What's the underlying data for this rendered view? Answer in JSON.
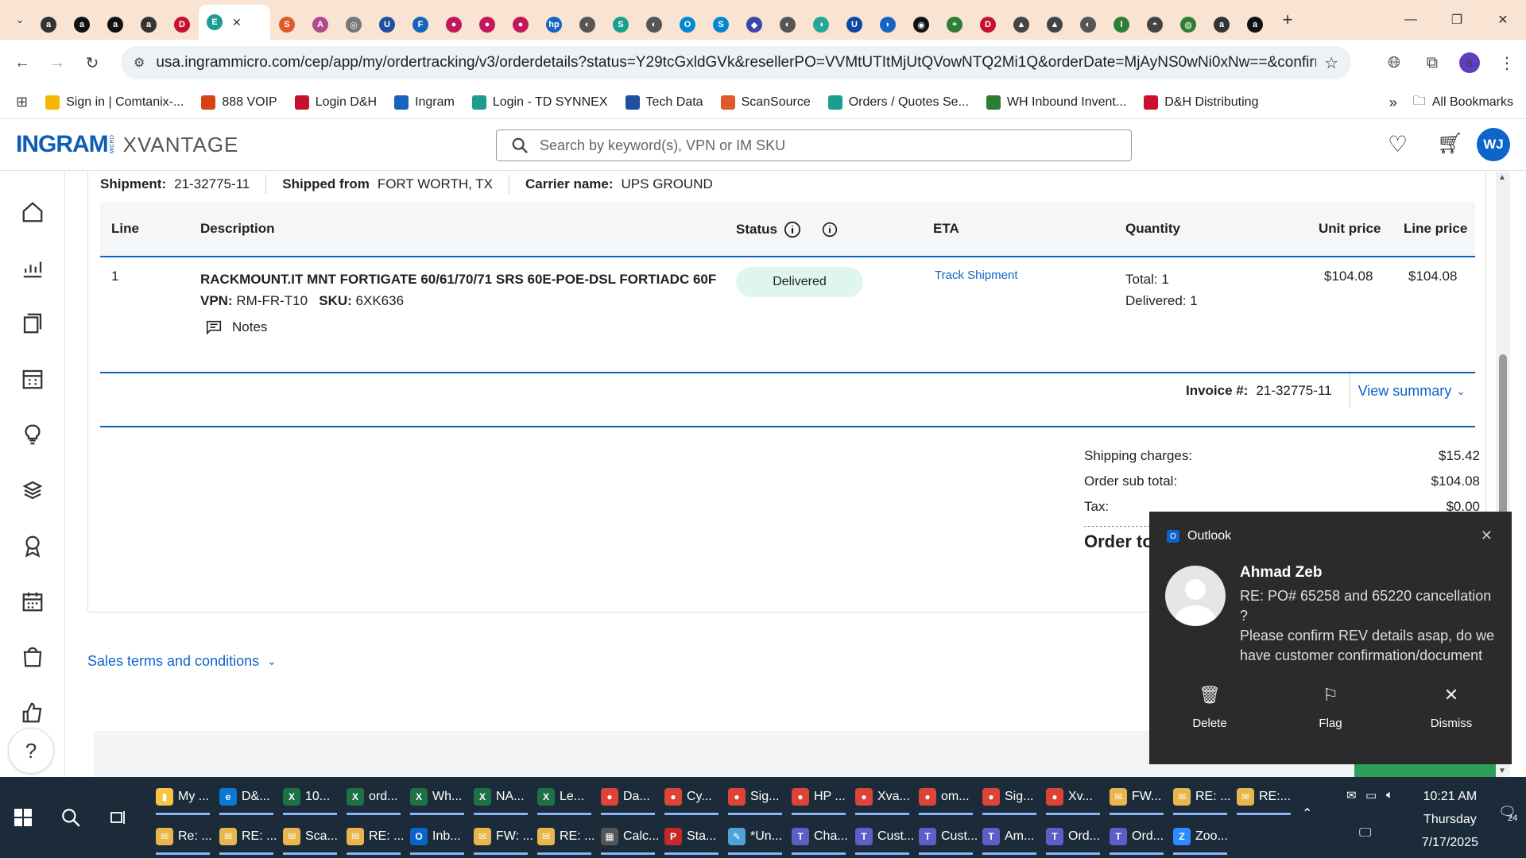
{
  "browser": {
    "url": "usa.ingrammicro.com/cep/app/my/ordertracking/v3/orderdetails?status=Y29tcGxldGVk&resellerPO=VVMtUTItMjUtQVowNTQ2Mi1Q&orderDate=MjAyNS0wNi0xNw==&confirmationNu...",
    "profile_initial": "B",
    "tabs": [
      {
        "color": "#333333",
        "glyph": "a"
      },
      {
        "color": "#111111",
        "glyph": "a"
      },
      {
        "color": "#111111",
        "glyph": "a"
      },
      {
        "color": "#333333",
        "glyph": "a"
      },
      {
        "color": "#c8102e",
        "glyph": "D"
      },
      {
        "color": "#1a9e8f",
        "glyph": "E"
      },
      {
        "color": "#e0592a",
        "glyph": "S"
      },
      {
        "color": "#b14a8a",
        "glyph": "A"
      },
      {
        "color": "#777777",
        "glyph": "◎"
      },
      {
        "color": "#1f4fa0",
        "glyph": "U"
      },
      {
        "color": "#1565c0",
        "glyph": "F"
      },
      {
        "color": "#c2185b",
        "glyph": "●"
      },
      {
        "color": "#c2185b",
        "glyph": "●"
      },
      {
        "color": "#c2185b",
        "glyph": "●"
      },
      {
        "color": "#1565c0",
        "glyph": "hp"
      },
      {
        "color": "#555555",
        "glyph": "◐"
      },
      {
        "color": "#1a9e8f",
        "glyph": "S"
      },
      {
        "color": "#555555",
        "glyph": "◐"
      },
      {
        "color": "#0288d1",
        "glyph": "O"
      },
      {
        "color": "#0288d1",
        "glyph": "S"
      },
      {
        "color": "#3949ab",
        "glyph": "◆"
      },
      {
        "color": "#555555",
        "glyph": "◐"
      },
      {
        "color": "#26a69a",
        "glyph": "◑"
      },
      {
        "color": "#0d47a1",
        "glyph": "U"
      },
      {
        "color": "#1565c0",
        "glyph": "◗"
      },
      {
        "color": "#111111",
        "glyph": "◉"
      },
      {
        "color": "#2e7d32",
        "glyph": "+"
      },
      {
        "color": "#c8102e",
        "glyph": "D"
      },
      {
        "color": "#444444",
        "glyph": "▲"
      },
      {
        "color": "#444444",
        "glyph": "▲"
      },
      {
        "color": "#555555",
        "glyph": "◐"
      },
      {
        "color": "#2e7d32",
        "glyph": "l"
      },
      {
        "color": "#444444",
        "glyph": "◓"
      },
      {
        "color": "#2e7d32",
        "glyph": "◍"
      },
      {
        "color": "#333333",
        "glyph": "a"
      },
      {
        "color": "#111111",
        "glyph": "a"
      }
    ],
    "bookmarks": [
      {
        "label": "Sign in | Comtanix-...",
        "color": "#f5b800"
      },
      {
        "label": "888 VOIP",
        "color": "#d84315"
      },
      {
        "label": "Login D&H",
        "color": "#c8102e"
      },
      {
        "label": "Ingram",
        "color": "#1565c0"
      },
      {
        "label": "Login - TD SYNNEX",
        "color": "#1a9e8f"
      },
      {
        "label": "Tech Data",
        "color": "#1f4fa0"
      },
      {
        "label": "ScanSource",
        "color": "#e0592a"
      },
      {
        "label": "Orders / Quotes Se...",
        "color": "#1a9e8f"
      },
      {
        "label": "WH Inbound Invent...",
        "color": "#2e7d32"
      },
      {
        "label": "D&H Distributing",
        "color": "#c8102e"
      }
    ],
    "all_bookmarks": "All Bookmarks"
  },
  "site": {
    "logo_main": "INGRAM",
    "logo_micro": "MICRO",
    "logo_product": "XVANTAGE",
    "search_placeholder": "Search by keyword(s), VPN or IM SKU",
    "user_initials": "WJ"
  },
  "shipment": {
    "shipment_label": "Shipment:",
    "shipment_value": "21-32775-11",
    "shipped_from_label": "Shipped from",
    "shipped_from_value": "FORT WORTH, TX",
    "carrier_label": "Carrier name:",
    "carrier_value": "UPS GROUND"
  },
  "table": {
    "headers": {
      "line": "Line",
      "description": "Description",
      "status": "Status",
      "eta": "ETA",
      "quantity": "Quantity",
      "unit_price": "Unit price",
      "line_price": "Line price"
    },
    "row": {
      "line": "1",
      "description": "RACKMOUNT.IT MNT FORTIGATE 60/61/70/71 SRS 60E-POE-DSL FORTIADC 60F",
      "vpn_label": "VPN:",
      "vpn_value": "RM-FR-T10",
      "sku_label": "SKU:",
      "sku_value": "6XK636",
      "notes": "Notes",
      "status": "Delivered",
      "eta_link": "Track Shipment",
      "qty_total": "Total: 1",
      "qty_delivered": "Delivered: 1",
      "unit_price": "$104.08",
      "line_price": "$104.08"
    }
  },
  "invoice": {
    "label": "Invoice #:",
    "value": "21-32775-11",
    "view_summary": "View summary"
  },
  "summary": {
    "shipping_label": "Shipping charges:",
    "shipping_value": "$15.42",
    "subtotal_label": "Order sub total:",
    "subtotal_value": "$104.08",
    "tax_label": "Tax:",
    "tax_value": "$0.00",
    "total_label": "Order to"
  },
  "sales_terms": "Sales terms and conditions",
  "toast": {
    "app": "Outlook",
    "from": "Ahmad Zeb",
    "subject": "RE: PO# 65258 and 65220 cancellation ?",
    "preview": "Please confirm REV details asap, do we have customer confirmation/document",
    "delete": "Delete",
    "flag": "Flag",
    "dismiss": "Dismiss"
  },
  "taskbar": {
    "row1": [
      {
        "label": "My ...",
        "color": "#f5c542",
        "glyph": "▮"
      },
      {
        "label": "D&...",
        "color": "#0a78d4",
        "glyph": "e"
      },
      {
        "label": "10...",
        "color": "#1e7145",
        "glyph": "X"
      },
      {
        "label": "ord...",
        "color": "#1e7145",
        "glyph": "X"
      },
      {
        "label": "Wh...",
        "color": "#1e7145",
        "glyph": "X"
      },
      {
        "label": "NA...",
        "color": "#1e7145",
        "glyph": "X"
      },
      {
        "label": "Le...",
        "color": "#1e7145",
        "glyph": "X"
      },
      {
        "label": "Da...",
        "color": "#db4437",
        "glyph": "●"
      },
      {
        "label": "Cy...",
        "color": "#db4437",
        "glyph": "●"
      },
      {
        "label": "Sig...",
        "color": "#db4437",
        "glyph": "●"
      },
      {
        "label": "HP ...",
        "color": "#db4437",
        "glyph": "●"
      },
      {
        "label": "Xva...",
        "color": "#db4437",
        "glyph": "●"
      },
      {
        "label": "om...",
        "color": "#db4437",
        "glyph": "●"
      },
      {
        "label": "Sig...",
        "color": "#db4437",
        "glyph": "●"
      },
      {
        "label": "Xv...",
        "color": "#db4437",
        "glyph": "●"
      },
      {
        "label": "FW...",
        "color": "#e8b64c",
        "glyph": "✉"
      },
      {
        "label": "RE: ...",
        "color": "#e8b64c",
        "glyph": "✉"
      },
      {
        "label": "RE:...",
        "color": "#e8b64c",
        "glyph": "✉"
      }
    ],
    "row2": [
      {
        "label": "Re: ...",
        "color": "#e8b64c",
        "glyph": "✉"
      },
      {
        "label": "RE: ...",
        "color": "#e8b64c",
        "glyph": "✉"
      },
      {
        "label": "Sca...",
        "color": "#e8b64c",
        "glyph": "✉"
      },
      {
        "label": "RE: ...",
        "color": "#e8b64c",
        "glyph": "✉"
      },
      {
        "label": "Inb...",
        "color": "#0a64c9",
        "glyph": "O"
      },
      {
        "label": "FW: ...",
        "color": "#e8b64c",
        "glyph": "✉"
      },
      {
        "label": "RE: ...",
        "color": "#e8b64c",
        "glyph": "✉"
      },
      {
        "label": "Calc...",
        "color": "#555555",
        "glyph": "▦"
      },
      {
        "label": "Sta...",
        "color": "#c62828",
        "glyph": "P"
      },
      {
        "label": "*Un...",
        "color": "#4fa3d9",
        "glyph": "✎"
      },
      {
        "label": "Cha...",
        "color": "#5b5fc7",
        "glyph": "T"
      },
      {
        "label": "Cust...",
        "color": "#5b5fc7",
        "glyph": "T"
      },
      {
        "label": "Cust...",
        "color": "#5b5fc7",
        "glyph": "T"
      },
      {
        "label": "Am...",
        "color": "#5b5fc7",
        "glyph": "T"
      },
      {
        "label": "Ord...",
        "color": "#5b5fc7",
        "glyph": "T"
      },
      {
        "label": "Ord...",
        "color": "#5b5fc7",
        "glyph": "T"
      },
      {
        "label": "Zoo...",
        "color": "#2d8cff",
        "glyph": "Z"
      }
    ],
    "time": "10:21 AM",
    "day": "Thursday",
    "date": "7/17/2025",
    "notification_count": "24"
  }
}
